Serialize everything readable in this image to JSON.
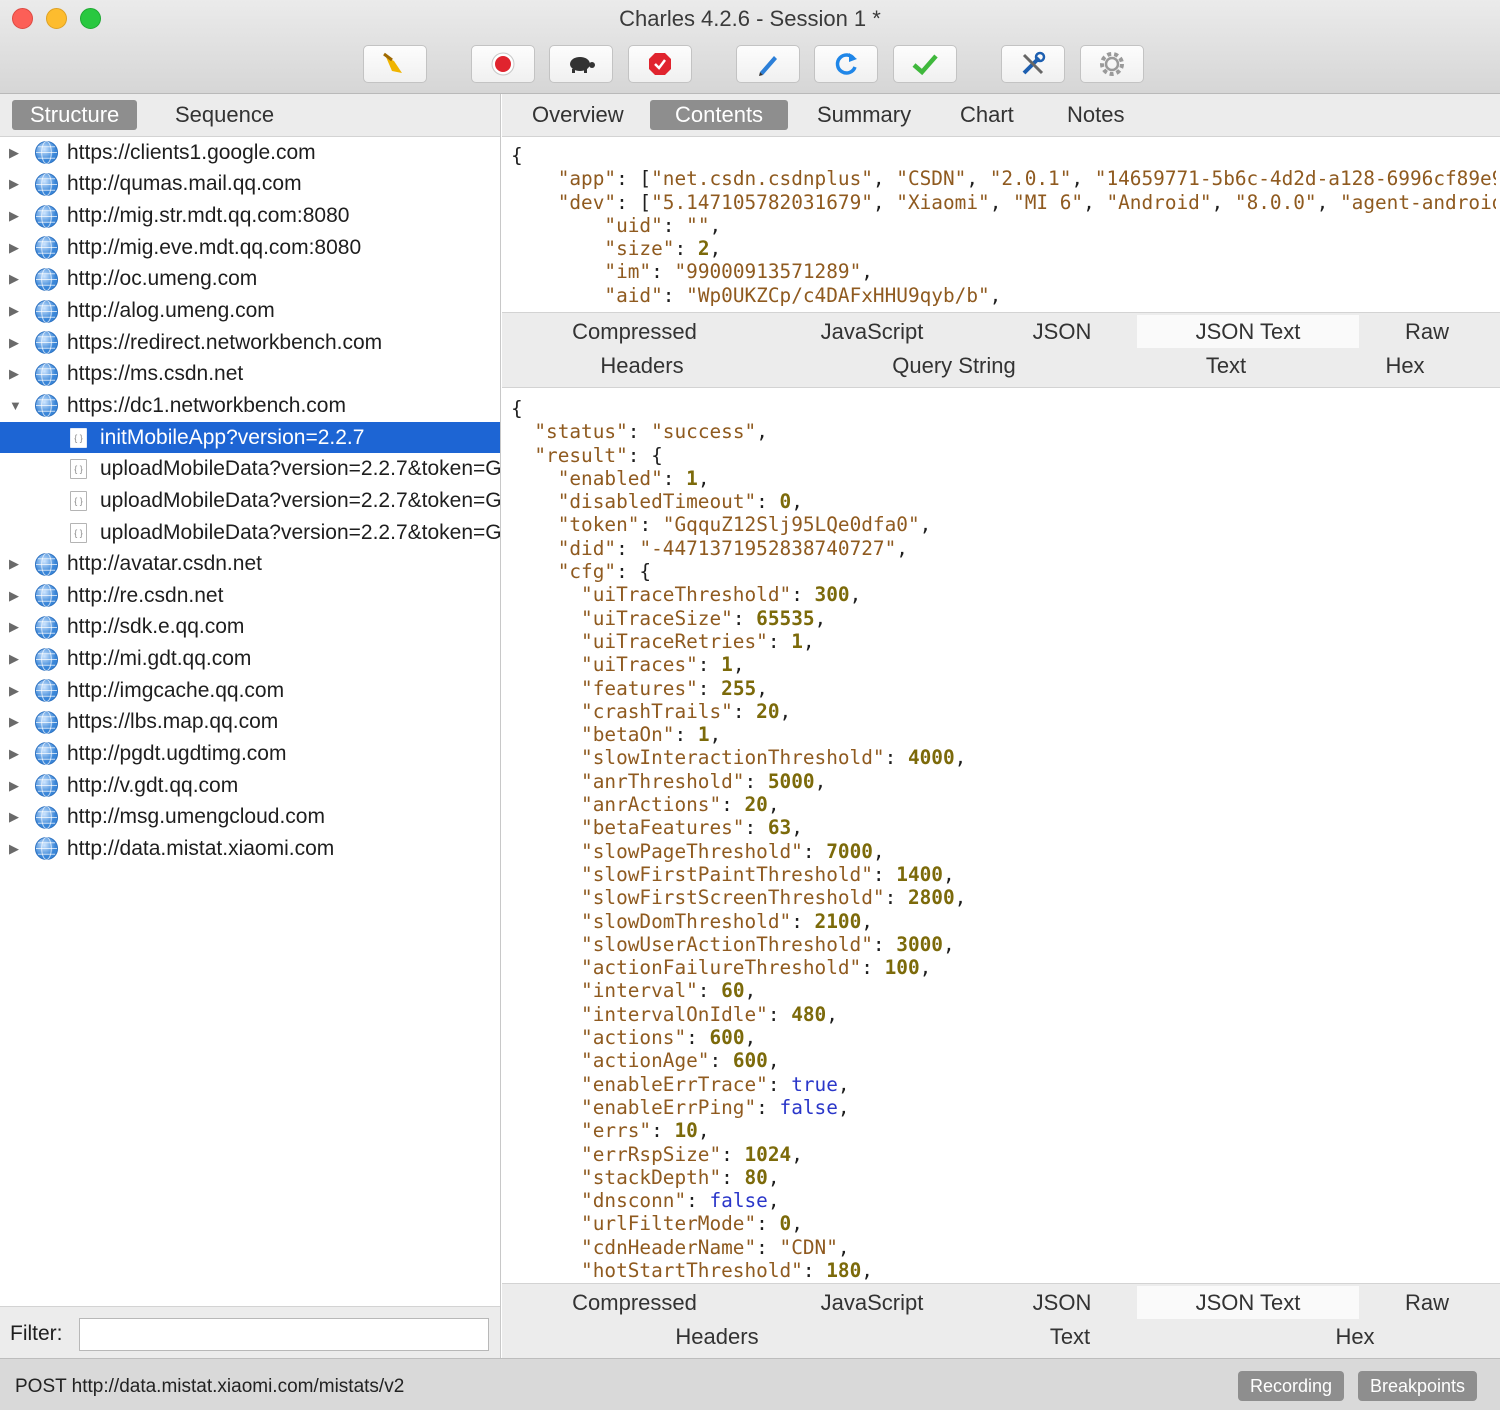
{
  "window": {
    "title": "Charles 4.2.6 - Session 1 *"
  },
  "toolbar": {
    "buttons": [
      "broom-icon",
      "record-icon",
      "turtle-icon",
      "breakpoint-icon",
      "pen-icon",
      "refresh-icon",
      "check-icon",
      "tools-icon",
      "gear-icon"
    ]
  },
  "left_pane": {
    "tabs": [
      "Structure",
      "Sequence"
    ],
    "active_tab": "Structure",
    "hosts_before": [
      "https://clients1.google.com",
      "http://qumas.mail.qq.com",
      "http://mig.str.mdt.qq.com:8080",
      "http://mig.eve.mdt.qq.com:8080",
      "http://oc.umeng.com",
      "http://alog.umeng.com",
      "https://redirect.networkbench.com",
      "https://ms.csdn.net"
    ],
    "expanded_host": "https://dc1.networkbench.com",
    "children": [
      "initMobileApp?version=2.2.7",
      "uploadMobileData?version=2.2.7&token=G",
      "uploadMobileData?version=2.2.7&token=G",
      "uploadMobileData?version=2.2.7&token=G"
    ],
    "hosts_after": [
      "http://avatar.csdn.net",
      "http://re.csdn.net",
      "http://sdk.e.qq.com",
      "http://mi.gdt.qq.com",
      "http://imgcache.qq.com",
      "https://lbs.map.qq.com",
      "http://pgdt.ugdtimg.com",
      "http://v.gdt.qq.com",
      "http://msg.umengcloud.com",
      "http://data.mistat.xiaomi.com"
    ],
    "filter_label": "Filter:",
    "filter_value": ""
  },
  "right_pane": {
    "tabs": [
      "Overview",
      "Contents",
      "Summary",
      "Chart",
      "Notes"
    ],
    "active_tab": "Contents",
    "request_lines": [
      [
        [
          "p",
          "{"
        ]
      ],
      [
        [
          "p",
          "    "
        ],
        [
          "k",
          "\"app\""
        ],
        [
          "p",
          ": ["
        ],
        [
          "s",
          "\"net.csdn.csdnplus\""
        ],
        [
          "p",
          ", "
        ],
        [
          "s",
          "\"CSDN\""
        ],
        [
          "p",
          ", "
        ],
        [
          "s",
          "\"2.0.1\""
        ],
        [
          "p",
          ", "
        ],
        [
          "s",
          "\"14659771-5b6c-4d2d-a128-6996cf89e9"
        ]
      ],
      [
        [
          "p",
          "    "
        ],
        [
          "k",
          "\"dev\""
        ],
        [
          "p",
          ": ["
        ],
        [
          "s",
          "\"5.147105782031679\""
        ],
        [
          "p",
          ", "
        ],
        [
          "s",
          "\"Xiaomi\""
        ],
        [
          "p",
          ", "
        ],
        [
          "s",
          "\"MI 6\""
        ],
        [
          "p",
          ", "
        ],
        [
          "s",
          "\"Android\""
        ],
        [
          "p",
          ", "
        ],
        [
          "s",
          "\"8.0.0\""
        ],
        [
          "p",
          ", "
        ],
        [
          "s",
          "\"agent-android"
        ]
      ],
      [
        [
          "p",
          "        "
        ],
        [
          "k",
          "\"uid\""
        ],
        [
          "p",
          ": "
        ],
        [
          "s",
          "\"\""
        ],
        [
          "p",
          ","
        ]
      ],
      [
        [
          "p",
          "        "
        ],
        [
          "k",
          "\"size\""
        ],
        [
          "p",
          ": "
        ],
        [
          "n",
          "2"
        ],
        [
          "p",
          ","
        ]
      ],
      [
        [
          "p",
          "        "
        ],
        [
          "k",
          "\"im\""
        ],
        [
          "p",
          ": "
        ],
        [
          "s",
          "\"99000913571289\""
        ],
        [
          "p",
          ","
        ]
      ],
      [
        [
          "p",
          "        "
        ],
        [
          "k",
          "\"aid\""
        ],
        [
          "p",
          ": "
        ],
        [
          "s",
          "\"Wp0UKZCp/c4DAFxHHU9qyb/b\""
        ],
        [
          "p",
          ","
        ]
      ]
    ],
    "request_view_tabs_row1": [
      "Compressed",
      "JavaScript",
      "JSON",
      "JSON Text",
      "Raw"
    ],
    "request_view_tabs_row2": [
      "Headers",
      "Query String",
      "Text",
      "Hex"
    ],
    "request_active_view": "JSON Text",
    "response_lines": [
      [
        [
          "p",
          "{"
        ]
      ],
      [
        [
          "p",
          "  "
        ],
        [
          "k",
          "\"status\""
        ],
        [
          "p",
          ": "
        ],
        [
          "s",
          "\"success\""
        ],
        [
          "p",
          ","
        ]
      ],
      [
        [
          "p",
          "  "
        ],
        [
          "k",
          "\"result\""
        ],
        [
          "p",
          ": {"
        ]
      ],
      [
        [
          "p",
          "    "
        ],
        [
          "k",
          "\"enabled\""
        ],
        [
          "p",
          ": "
        ],
        [
          "n",
          "1"
        ],
        [
          "p",
          ","
        ]
      ],
      [
        [
          "p",
          "    "
        ],
        [
          "k",
          "\"disabledTimeout\""
        ],
        [
          "p",
          ": "
        ],
        [
          "n",
          "0"
        ],
        [
          "p",
          ","
        ]
      ],
      [
        [
          "p",
          "    "
        ],
        [
          "k",
          "\"token\""
        ],
        [
          "p",
          ": "
        ],
        [
          "s",
          "\"GqquZ12Slj95LQe0dfa0\""
        ],
        [
          "p",
          ","
        ]
      ],
      [
        [
          "p",
          "    "
        ],
        [
          "k",
          "\"did\""
        ],
        [
          "p",
          ": "
        ],
        [
          "s",
          "\"-4471371952838740727\""
        ],
        [
          "p",
          ","
        ]
      ],
      [
        [
          "p",
          "    "
        ],
        [
          "k",
          "\"cfg\""
        ],
        [
          "p",
          ": {"
        ]
      ],
      [
        [
          "p",
          "      "
        ],
        [
          "k",
          "\"uiTraceThreshold\""
        ],
        [
          "p",
          ": "
        ],
        [
          "n",
          "300"
        ],
        [
          "p",
          ","
        ]
      ],
      [
        [
          "p",
          "      "
        ],
        [
          "k",
          "\"uiTraceSize\""
        ],
        [
          "p",
          ": "
        ],
        [
          "n",
          "65535"
        ],
        [
          "p",
          ","
        ]
      ],
      [
        [
          "p",
          "      "
        ],
        [
          "k",
          "\"uiTraceRetries\""
        ],
        [
          "p",
          ": "
        ],
        [
          "n",
          "1"
        ],
        [
          "p",
          ","
        ]
      ],
      [
        [
          "p",
          "      "
        ],
        [
          "k",
          "\"uiTraces\""
        ],
        [
          "p",
          ": "
        ],
        [
          "n",
          "1"
        ],
        [
          "p",
          ","
        ]
      ],
      [
        [
          "p",
          "      "
        ],
        [
          "k",
          "\"features\""
        ],
        [
          "p",
          ": "
        ],
        [
          "n",
          "255"
        ],
        [
          "p",
          ","
        ]
      ],
      [
        [
          "p",
          "      "
        ],
        [
          "k",
          "\"crashTrails\""
        ],
        [
          "p",
          ": "
        ],
        [
          "n",
          "20"
        ],
        [
          "p",
          ","
        ]
      ],
      [
        [
          "p",
          "      "
        ],
        [
          "k",
          "\"betaOn\""
        ],
        [
          "p",
          ": "
        ],
        [
          "n",
          "1"
        ],
        [
          "p",
          ","
        ]
      ],
      [
        [
          "p",
          "      "
        ],
        [
          "k",
          "\"slowInteractionThreshold\""
        ],
        [
          "p",
          ": "
        ],
        [
          "n",
          "4000"
        ],
        [
          "p",
          ","
        ]
      ],
      [
        [
          "p",
          "      "
        ],
        [
          "k",
          "\"anrThreshold\""
        ],
        [
          "p",
          ": "
        ],
        [
          "n",
          "5000"
        ],
        [
          "p",
          ","
        ]
      ],
      [
        [
          "p",
          "      "
        ],
        [
          "k",
          "\"anrActions\""
        ],
        [
          "p",
          ": "
        ],
        [
          "n",
          "20"
        ],
        [
          "p",
          ","
        ]
      ],
      [
        [
          "p",
          "      "
        ],
        [
          "k",
          "\"betaFeatures\""
        ],
        [
          "p",
          ": "
        ],
        [
          "n",
          "63"
        ],
        [
          "p",
          ","
        ]
      ],
      [
        [
          "p",
          "      "
        ],
        [
          "k",
          "\"slowPageThreshold\""
        ],
        [
          "p",
          ": "
        ],
        [
          "n",
          "7000"
        ],
        [
          "p",
          ","
        ]
      ],
      [
        [
          "p",
          "      "
        ],
        [
          "k",
          "\"slowFirstPaintThreshold\""
        ],
        [
          "p",
          ": "
        ],
        [
          "n",
          "1400"
        ],
        [
          "p",
          ","
        ]
      ],
      [
        [
          "p",
          "      "
        ],
        [
          "k",
          "\"slowFirstScreenThreshold\""
        ],
        [
          "p",
          ": "
        ],
        [
          "n",
          "2800"
        ],
        [
          "p",
          ","
        ]
      ],
      [
        [
          "p",
          "      "
        ],
        [
          "k",
          "\"slowDomThreshold\""
        ],
        [
          "p",
          ": "
        ],
        [
          "n",
          "2100"
        ],
        [
          "p",
          ","
        ]
      ],
      [
        [
          "p",
          "      "
        ],
        [
          "k",
          "\"slowUserActionThreshold\""
        ],
        [
          "p",
          ": "
        ],
        [
          "n",
          "3000"
        ],
        [
          "p",
          ","
        ]
      ],
      [
        [
          "p",
          "      "
        ],
        [
          "k",
          "\"actionFailureThreshold\""
        ],
        [
          "p",
          ": "
        ],
        [
          "n",
          "100"
        ],
        [
          "p",
          ","
        ]
      ],
      [
        [
          "p",
          "      "
        ],
        [
          "k",
          "\"interval\""
        ],
        [
          "p",
          ": "
        ],
        [
          "n",
          "60"
        ],
        [
          "p",
          ","
        ]
      ],
      [
        [
          "p",
          "      "
        ],
        [
          "k",
          "\"intervalOnIdle\""
        ],
        [
          "p",
          ": "
        ],
        [
          "n",
          "480"
        ],
        [
          "p",
          ","
        ]
      ],
      [
        [
          "p",
          "      "
        ],
        [
          "k",
          "\"actions\""
        ],
        [
          "p",
          ": "
        ],
        [
          "n",
          "600"
        ],
        [
          "p",
          ","
        ]
      ],
      [
        [
          "p",
          "      "
        ],
        [
          "k",
          "\"actionAge\""
        ],
        [
          "p",
          ": "
        ],
        [
          "n",
          "600"
        ],
        [
          "p",
          ","
        ]
      ],
      [
        [
          "p",
          "      "
        ],
        [
          "k",
          "\"enableErrTrace\""
        ],
        [
          "p",
          ": "
        ],
        [
          "b",
          "true"
        ],
        [
          "p",
          ","
        ]
      ],
      [
        [
          "p",
          "      "
        ],
        [
          "k",
          "\"enableErrPing\""
        ],
        [
          "p",
          ": "
        ],
        [
          "b",
          "false"
        ],
        [
          "p",
          ","
        ]
      ],
      [
        [
          "p",
          "      "
        ],
        [
          "k",
          "\"errs\""
        ],
        [
          "p",
          ": "
        ],
        [
          "n",
          "10"
        ],
        [
          "p",
          ","
        ]
      ],
      [
        [
          "p",
          "      "
        ],
        [
          "k",
          "\"errRspSize\""
        ],
        [
          "p",
          ": "
        ],
        [
          "n",
          "1024"
        ],
        [
          "p",
          ","
        ]
      ],
      [
        [
          "p",
          "      "
        ],
        [
          "k",
          "\"stackDepth\""
        ],
        [
          "p",
          ": "
        ],
        [
          "n",
          "80"
        ],
        [
          "p",
          ","
        ]
      ],
      [
        [
          "p",
          "      "
        ],
        [
          "k",
          "\"dnsconn\""
        ],
        [
          "p",
          ": "
        ],
        [
          "b",
          "false"
        ],
        [
          "p",
          ","
        ]
      ],
      [
        [
          "p",
          "      "
        ],
        [
          "k",
          "\"urlFilterMode\""
        ],
        [
          "p",
          ": "
        ],
        [
          "n",
          "0"
        ],
        [
          "p",
          ","
        ]
      ],
      [
        [
          "p",
          "      "
        ],
        [
          "k",
          "\"cdnHeaderName\""
        ],
        [
          "p",
          ": "
        ],
        [
          "s",
          "\"CDN\""
        ],
        [
          "p",
          ","
        ]
      ],
      [
        [
          "p",
          "      "
        ],
        [
          "k",
          "\"hotStartThreshold\""
        ],
        [
          "p",
          ": "
        ],
        [
          "n",
          "180"
        ],
        [
          "p",
          ","
        ]
      ]
    ],
    "response_view_tabs_row1": [
      "Compressed",
      "JavaScript",
      "JSON",
      "JSON Text",
      "Raw"
    ],
    "response_view_tabs_row2": [
      "Headers",
      "Text",
      "Hex"
    ],
    "response_active_view": "JSON Text"
  },
  "status_bar": {
    "text": "POST http://data.mistat.xiaomi.com/mistats/v2",
    "buttons": [
      "Recording",
      "Breakpoints"
    ]
  },
  "colors": {
    "selection": "#1d65d4",
    "json_key": "#8f5a1f",
    "json_number": "#7c6a0a",
    "json_bool": "#2a36c9"
  }
}
